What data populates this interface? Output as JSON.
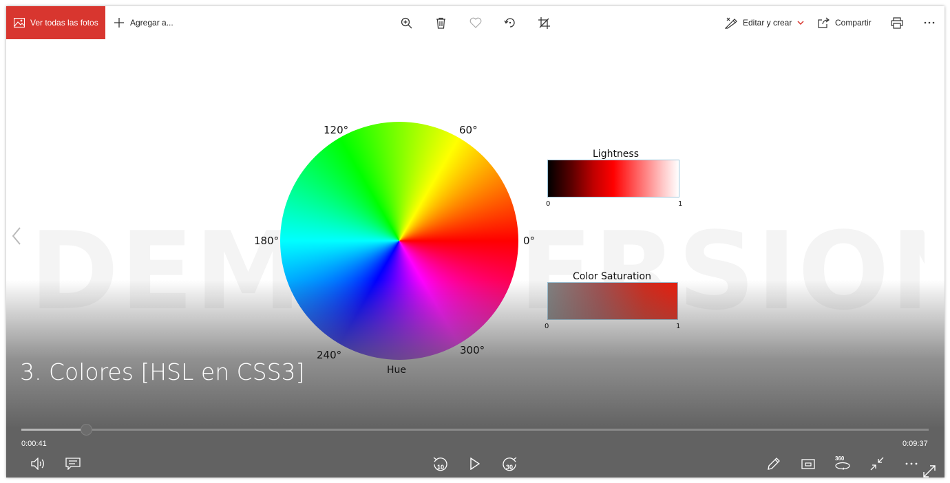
{
  "toolbar": {
    "all_photos_label": "Ver todas las fotos",
    "add_to_label": "Agregar a...",
    "edit_create_label": "Editar y crear",
    "share_label": "Compartir",
    "icons": [
      "photos-icon",
      "plus-icon",
      "zoom-in-icon",
      "delete-icon",
      "heart-icon",
      "rotate-icon",
      "crop-icon",
      "edit-create-icon",
      "chevron-down-icon",
      "share-icon",
      "print-icon",
      "more-icon"
    ]
  },
  "image": {
    "watermark": "DEMO VERSION",
    "wheel_labels": {
      "d0": "0°",
      "d60": "60°",
      "d120": "120°",
      "d180": "180°",
      "d240": "240°",
      "d300": "300°"
    },
    "hue_label": "Hue",
    "lightness": {
      "title": "Lightness",
      "min": "0",
      "max": "1"
    },
    "saturation": {
      "title": "Color Saturation",
      "min": "0",
      "max": "1"
    }
  },
  "video": {
    "title": "3. Colores [HSL en CSS3]",
    "current_time": "0:00:41",
    "total_time": "0:09:37",
    "progress_fraction": 0.071,
    "skip_back_label": "10",
    "skip_forward_label": "30",
    "label_360": "360"
  },
  "colors": {
    "accent": "#d8362f",
    "controls_bg": "#626262"
  }
}
